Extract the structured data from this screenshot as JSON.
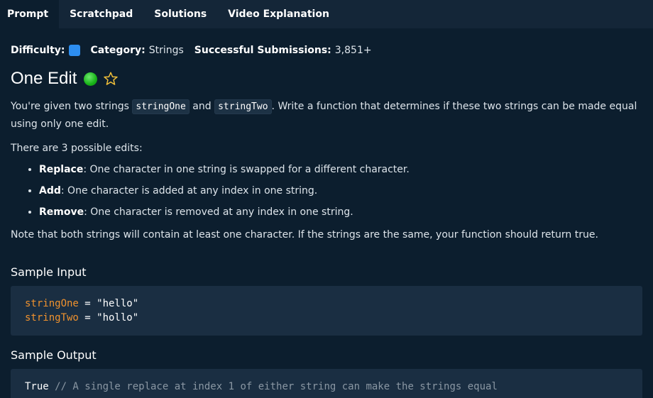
{
  "tabs": [
    {
      "label": "Prompt",
      "active": true
    },
    {
      "label": "Scratchpad",
      "active": false
    },
    {
      "label": "Solutions",
      "active": false
    },
    {
      "label": "Video Explanation",
      "active": false
    }
  ],
  "meta": {
    "difficulty_label": "Difficulty:",
    "difficulty_color": "#2d8ef0",
    "category_label": "Category:",
    "category_value": "Strings",
    "submissions_label": "Successful Submissions:",
    "submissions_value": "3,851+"
  },
  "title": "One Edit",
  "status_color": "#17b317",
  "icons": {
    "status": "green-circle-icon",
    "favorite": "star-icon"
  },
  "prompt": {
    "p1_part1": "You're given two strings ",
    "code1": "stringOne",
    "p1_and": " and ",
    "code2": "stringTwo",
    "p1_part2": ". Write a function that determines if these two strings can be made equal using only one edit.",
    "p2": "There are 3 possible edits:",
    "edits": [
      {
        "name": "Replace",
        "desc": ": One character in one string is swapped for a different character."
      },
      {
        "name": "Add",
        "desc": ": One character is added at any index in one string."
      },
      {
        "name": "Remove",
        "desc": ": One character is removed at any index in one string."
      }
    ],
    "note": "Note that both strings will contain at least one character. If the strings are the same, your function should return true."
  },
  "sample_input": {
    "heading": "Sample Input",
    "lines": [
      {
        "var": "stringOne",
        "rest": " = \"hello\""
      },
      {
        "var": "stringTwo",
        "rest": " = \"hollo\""
      }
    ]
  },
  "sample_output": {
    "heading": "Sample Output",
    "value": "True",
    "comment": " // A single replace at index 1 of either string can make the strings equal"
  }
}
